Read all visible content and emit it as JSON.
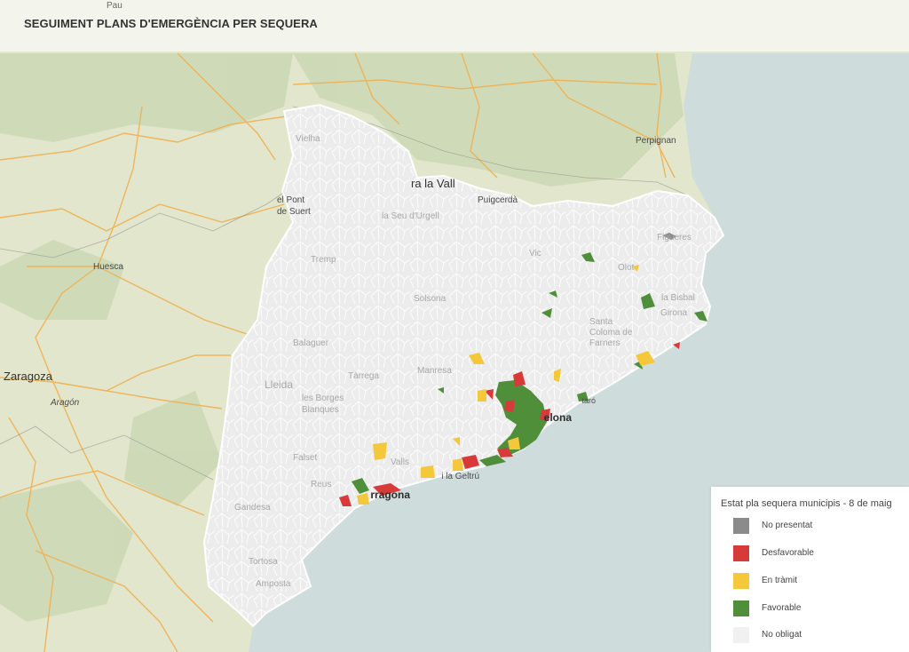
{
  "header": {
    "title": "SEGUIMENT PLANS D'EMERGÈNCIA PER SEQUERA"
  },
  "map": {
    "place_labels": [
      {
        "id": "pau",
        "text": "Pau"
      },
      {
        "id": "perpignan",
        "text": "Perpignan"
      },
      {
        "id": "huesca",
        "text": "Huesca"
      },
      {
        "id": "zaragoza",
        "text": "Zaragoza"
      },
      {
        "id": "aragon",
        "text": "Aragón"
      },
      {
        "id": "vielha",
        "text": "Vielha"
      },
      {
        "id": "pont-suert",
        "text": "el Pont de Suert"
      },
      {
        "id": "seu-urgell",
        "text": "la Seu d'Urgell"
      },
      {
        "id": "puigcerda",
        "text": "Puigcerdà"
      },
      {
        "id": "la-vall",
        "text": "ra la Vall"
      },
      {
        "id": "tremp",
        "text": "Tremp"
      },
      {
        "id": "balaguer",
        "text": "Balaguer"
      },
      {
        "id": "lleida",
        "text": "Lleida"
      },
      {
        "id": "manresa",
        "text": "Manresa"
      },
      {
        "id": "tarrega",
        "text": "Tàrrega"
      },
      {
        "id": "les-borges",
        "text": "les Borges Blanques"
      },
      {
        "id": "valls",
        "text": "Valls"
      },
      {
        "id": "reus",
        "text": "Reus"
      },
      {
        "id": "tarragona",
        "text": "Tarragona"
      },
      {
        "id": "vilanova",
        "text": "Vilanova i la Geltrú"
      },
      {
        "id": "barcelona",
        "text": "Barcelona"
      },
      {
        "id": "mataro",
        "text": "Mataró"
      },
      {
        "id": "girona",
        "text": "Girona"
      },
      {
        "id": "figueres",
        "text": "Figueres"
      },
      {
        "id": "olot",
        "text": "Olot"
      },
      {
        "id": "santa-coloma",
        "text": "Santa Coloma de Farners"
      },
      {
        "id": "tortosa",
        "text": "Tortosa"
      },
      {
        "id": "amposta",
        "text": "Amposta"
      },
      {
        "id": "gandesa",
        "text": "Gandesa"
      },
      {
        "id": "falset",
        "text": "Falset"
      },
      {
        "id": "la-bisbal",
        "text": "la Bisbal"
      },
      {
        "id": "vic",
        "text": "Vic"
      },
      {
        "id": "solsona",
        "text": "Solsona"
      }
    ]
  },
  "legend": {
    "title": "Estat pla sequera municipis - 8 de maig",
    "items": [
      {
        "label": "No presentat",
        "color": "#8b8b8b"
      },
      {
        "label": "Desfavorable",
        "color": "#d83a3a"
      },
      {
        "label": "En tràmit",
        "color": "#f5c73b"
      },
      {
        "label": "Favorable",
        "color": "#4f8f3a"
      },
      {
        "label": "No obligat",
        "color": "#f1f1f1"
      }
    ]
  },
  "colors": {
    "sea": "#cfdcdc",
    "land": "#e2e6cc",
    "terrain": "#cbd8b4",
    "region_fill": "#ececec",
    "region_border": "#ffffff",
    "roads": "#f0b050",
    "borders": "#8a8a8a"
  }
}
